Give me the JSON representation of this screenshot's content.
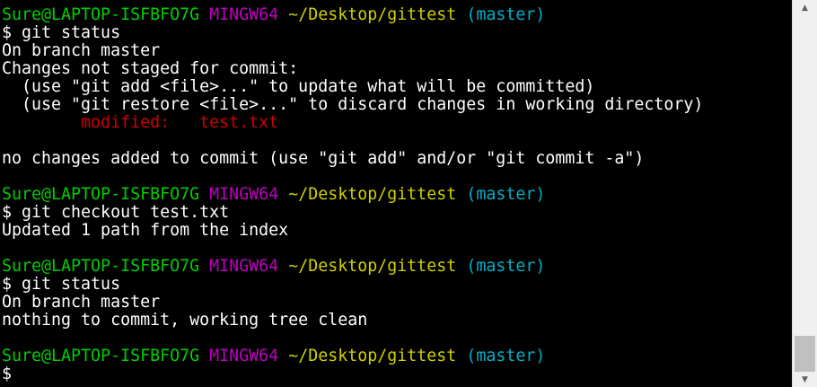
{
  "terminal": {
    "prompt": {
      "user": "Sure@LAPTOP-ISFBFO7G",
      "env": "MINGW64",
      "path": "~/Desktop/gittest",
      "branch": "(master)"
    },
    "lines": [
      {
        "kind": "prompt"
      },
      {
        "kind": "text",
        "text": "$ git status"
      },
      {
        "kind": "text",
        "text": "On branch master"
      },
      {
        "kind": "text",
        "text": "Changes not staged for commit:"
      },
      {
        "kind": "text",
        "text": "  (use \"git add <file>...\" to update what will be committed)"
      },
      {
        "kind": "text",
        "text": "  (use \"git restore <file>...\" to discard changes in working directory)"
      },
      {
        "kind": "modified",
        "label": "        modified:",
        "file": "   test.txt"
      },
      {
        "kind": "text",
        "text": ""
      },
      {
        "kind": "text",
        "text": "no changes added to commit (use \"git add\" and/or \"git commit -a\")"
      },
      {
        "kind": "text",
        "text": ""
      },
      {
        "kind": "prompt"
      },
      {
        "kind": "text",
        "text": "$ git checkout test.txt"
      },
      {
        "kind": "text",
        "text": "Updated 1 path from the index"
      },
      {
        "kind": "text",
        "text": ""
      },
      {
        "kind": "prompt"
      },
      {
        "kind": "text",
        "text": "$ git status"
      },
      {
        "kind": "text",
        "text": "On branch master"
      },
      {
        "kind": "text",
        "text": "nothing to commit, working tree clean"
      },
      {
        "kind": "text",
        "text": ""
      },
      {
        "kind": "prompt"
      },
      {
        "kind": "text",
        "text": "$"
      }
    ]
  },
  "scrollbar": {
    "up_icon": "chevron-up-icon",
    "down_icon": "chevron-down-icon",
    "up_glyph": "▲",
    "down_glyph": "▼",
    "scroll_position": 1.0,
    "visible_fraction": 0.1
  },
  "colors": {
    "background": "#000000",
    "user_host": "#00d000",
    "env": "#c000c0",
    "path": "#d0d000",
    "branch": "#00b0c8",
    "modified": "#d00000",
    "text": "#ffffff"
  }
}
